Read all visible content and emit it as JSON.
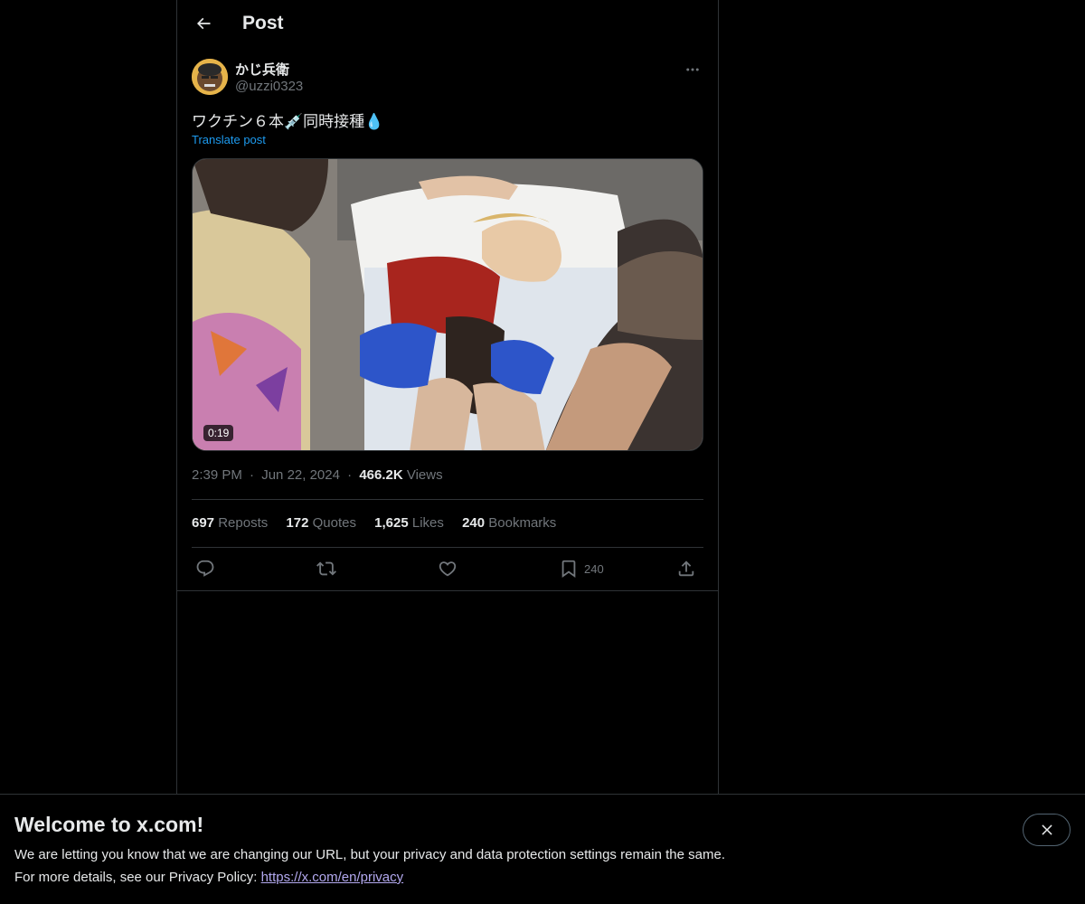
{
  "header": {
    "title": "Post",
    "back_icon": "arrow-left-icon"
  },
  "author": {
    "display_name": "かじ兵衛",
    "handle": "@uzzi0323",
    "more_icon": "more-horizontal-icon"
  },
  "post": {
    "text": "ワクチン６本💉同時接種💧",
    "translate_label": "Translate post",
    "media": {
      "type": "video",
      "duration": "0:19"
    },
    "time": "2:39 PM",
    "date": "Jun 22, 2024",
    "separator": "·",
    "views_count": "466.2K",
    "views_label": "Views"
  },
  "stats": {
    "reposts_count": "697",
    "reposts_label": "Reposts",
    "quotes_count": "172",
    "quotes_label": "Quotes",
    "likes_count": "1,625",
    "likes_label": "Likes",
    "bookmarks_count": "240",
    "bookmarks_label": "Bookmarks"
  },
  "actions": {
    "reply_icon": "reply-icon",
    "repost_icon": "repost-icon",
    "like_icon": "heart-icon",
    "bookmark_icon": "bookmark-icon",
    "bookmark_count": "240",
    "share_icon": "share-icon"
  },
  "banner": {
    "title": "Welcome to x.com!",
    "line1": "We are letting you know that we are changing our URL, but your privacy and data protection settings remain the same.",
    "line2_prefix": "For more details, see our Privacy Policy: ",
    "link_text": "https://x.com/en/privacy",
    "close_icon": "close-icon"
  },
  "colors": {
    "background": "#000000",
    "text_primary": "#e7e9ea",
    "text_secondary": "#71767b",
    "accent": "#1d9bf0",
    "border": "#2f3336",
    "link": "#b3a9ef"
  }
}
